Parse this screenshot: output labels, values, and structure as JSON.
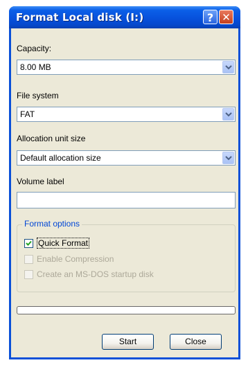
{
  "window": {
    "title": "Format  Local disk (I:)"
  },
  "titlebar_buttons": {
    "help": "?",
    "close": "✕"
  },
  "capacity": {
    "label": "Capacity:",
    "value": "8.00 MB"
  },
  "file_system": {
    "label": "File system",
    "value": "FAT"
  },
  "allocation": {
    "label": "Allocation unit size",
    "value": "Default allocation size"
  },
  "volume": {
    "label": "Volume label",
    "value": ""
  },
  "options": {
    "title": "Format options",
    "quick_format": {
      "label": "Quick Format",
      "checked": true,
      "enabled": true
    },
    "compression": {
      "label": "Enable Compression",
      "checked": false,
      "enabled": false
    },
    "msdos": {
      "label": "Create an MS-DOS startup disk",
      "checked": false,
      "enabled": false
    }
  },
  "progress": {
    "value": 0
  },
  "buttons": {
    "start": "Start",
    "close": "Close"
  },
  "icons": [
    "help-icon",
    "close-icon",
    "chevron-down-icon",
    "checkmark-icon"
  ],
  "colors": {
    "title_blue": "#0a50d8",
    "dialog_bg": "#ece9d8",
    "group_title": "#0046d5",
    "disabled_text": "#aca899"
  }
}
